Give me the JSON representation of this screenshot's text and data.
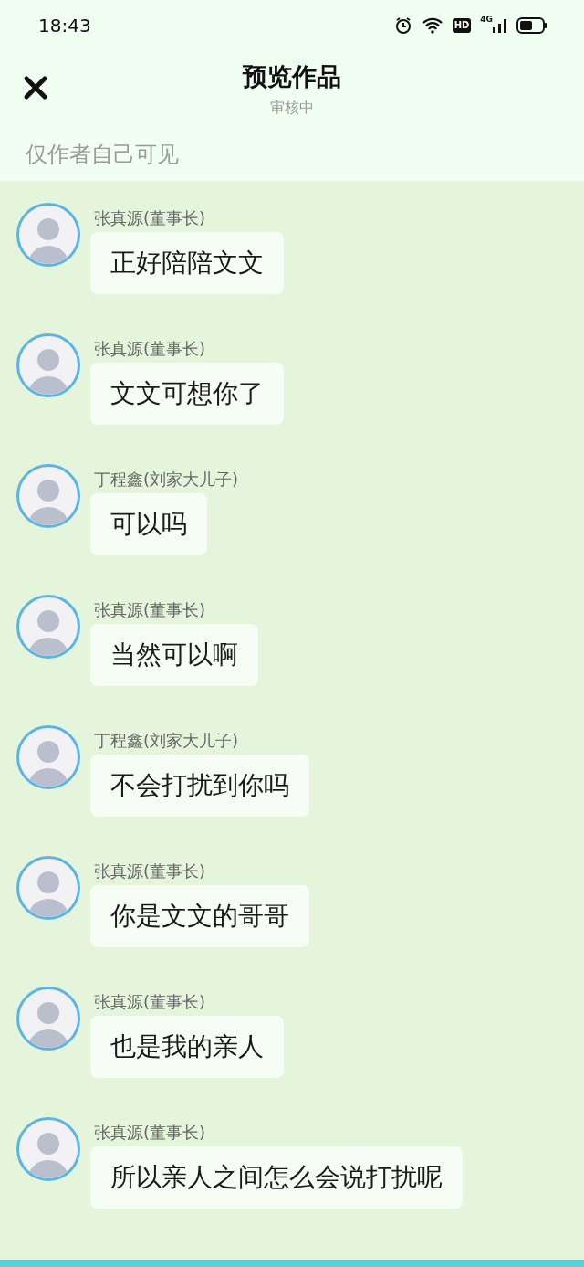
{
  "status_bar": {
    "time": "18:43",
    "hd": "HD",
    "network": "4G"
  },
  "header": {
    "title": "预览作品",
    "subtitle": "审核中"
  },
  "notice": "仅作者自己可见",
  "messages": [
    {
      "sender": "张真源(董事长)",
      "text": "正好陪陪文文"
    },
    {
      "sender": "张真源(董事长)",
      "text": "文文可想你了"
    },
    {
      "sender": "丁程鑫(刘家大儿子)",
      "text": "可以吗"
    },
    {
      "sender": "张真源(董事长)",
      "text": "当然可以啊"
    },
    {
      "sender": "丁程鑫(刘家大儿子)",
      "text": "不会打扰到你吗"
    },
    {
      "sender": "张真源(董事长)",
      "text": "你是文文的哥哥"
    },
    {
      "sender": "张真源(董事长)",
      "text": "也是我的亲人"
    },
    {
      "sender": "张真源(董事长)",
      "text": "所以亲人之间怎么会说打扰呢"
    }
  ]
}
